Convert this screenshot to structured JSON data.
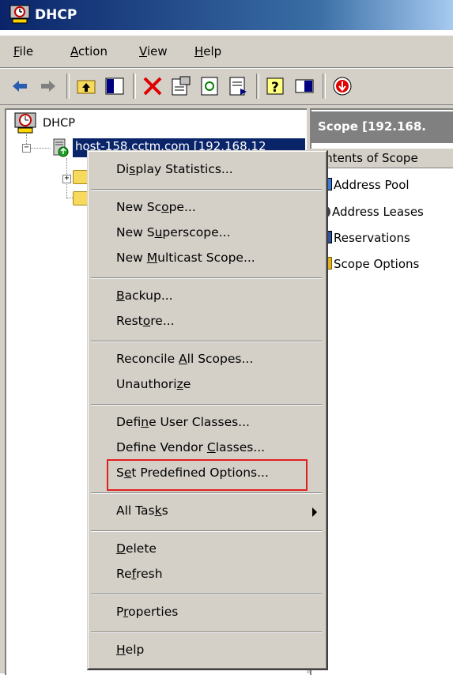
{
  "window": {
    "title": "DHCP"
  },
  "menubar": {
    "file": "File",
    "action": "Action",
    "view": "View",
    "help": "Help"
  },
  "toolbar": {
    "buttons": [
      "back-arrow-icon",
      "forward-arrow-icon",
      "up-folder-icon",
      "show-hide-tree-icon",
      "delete-icon",
      "properties-icon",
      "refresh-icon",
      "export-list-icon",
      "help-icon",
      "console-pane-icon",
      "stop-icon"
    ]
  },
  "tree": {
    "root_label": "DHCP",
    "server_label": "host-158.cctm.com [192.168.12"
  },
  "right_pane": {
    "header": "Scope [192.168.",
    "column": "ontents of Scope",
    "items": [
      "Address Pool",
      "Address Leases",
      "Reservations",
      "Scope Options"
    ]
  },
  "context_menu": {
    "display_statistics": "Display Statistics...",
    "new_scope": "New Scope...",
    "new_superscope": "New Superscope...",
    "new_multicast_scope": "New Multicast Scope...",
    "backup": "Backup...",
    "restore": "Restore...",
    "reconcile_all_scopes": "Reconcile All Scopes...",
    "unauthorize": "Unauthorize",
    "define_user_classes": "Define User Classes...",
    "define_vendor_classes": "Define Vendor Classes...",
    "set_predefined_options": "Set Predefined Options...",
    "all_tasks": "All Tasks",
    "delete": "Delete",
    "refresh": "Refresh",
    "properties": "Properties",
    "help": "Help"
  },
  "colors": {
    "title_bar": "#0a246a",
    "selection": "#0a246a",
    "chrome": "#d4d0c8",
    "highlight_box": "#e02020"
  }
}
